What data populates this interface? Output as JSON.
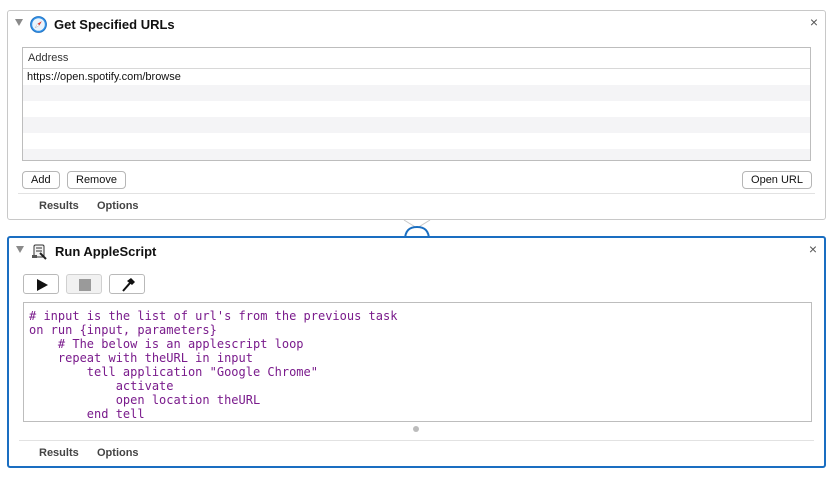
{
  "action1": {
    "title": "Get Specified URLs",
    "icon": "safari-compass-icon",
    "table": {
      "header": "Address",
      "rows": [
        "https://open.spotify.com/browse",
        "",
        "",
        "",
        "",
        "",
        ""
      ]
    },
    "buttons": {
      "add": "Add",
      "remove": "Remove",
      "open_url": "Open URL"
    },
    "footer": {
      "results": "Results",
      "options": "Options"
    }
  },
  "action2": {
    "title": "Run AppleScript",
    "icon": "applescript-scroll-icon",
    "toolbar": [
      "play-icon",
      "stop-icon",
      "hammer-icon"
    ],
    "code": [
      "# input is the list of url's from the previous task",
      "on run {input, parameters}",
      "    # The below is an applescript loop",
      "    repeat with theURL in input",
      "        tell application \"Google Chrome\"",
      "            activate",
      "            open location theURL",
      "        end tell"
    ],
    "footer": {
      "results": "Results",
      "options": "Options"
    }
  },
  "colors": {
    "selected_border": "#1a6ec1",
    "code_text": "#7a1b8c"
  }
}
